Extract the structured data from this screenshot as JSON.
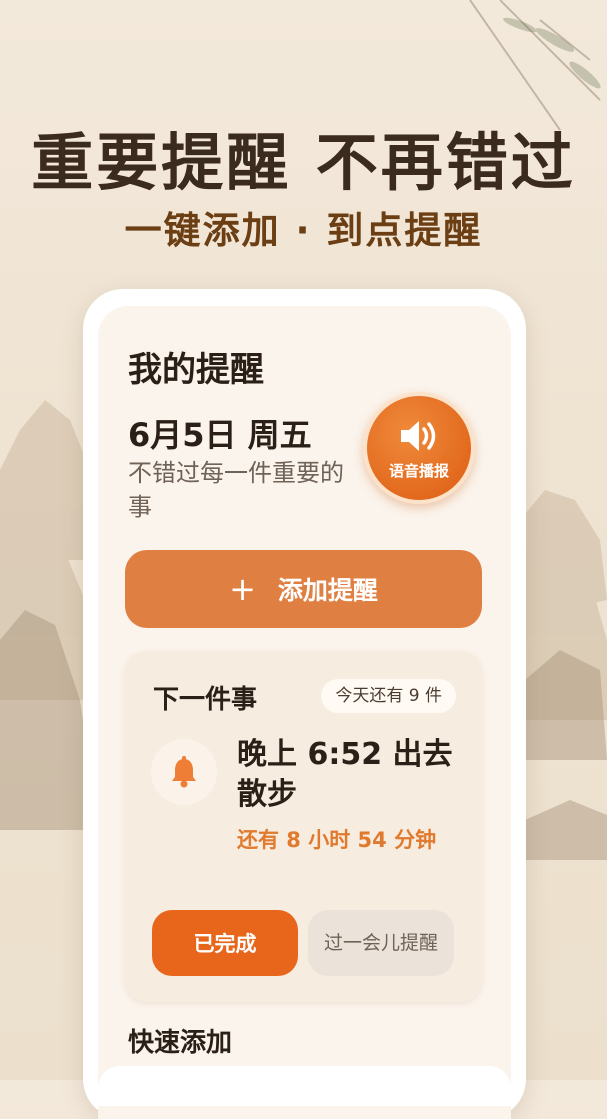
{
  "hero": {
    "headline": "重要提醒 不再错过",
    "subline": "一键添加 · 到点提醒"
  },
  "app": {
    "title": "我的提醒",
    "date": "6月5日 周五",
    "tagline": "不错过每一件重要的事",
    "voice_button": {
      "label": "语音播报",
      "icon": "speaker-icon"
    },
    "add_button": {
      "label": "添加提醒",
      "icon": "plus-icon"
    },
    "next_item": {
      "section_title": "下一件事",
      "remaining_today": "今天还有 9 件",
      "icon": "bell-icon",
      "event": "晚上 6:52 出去散步",
      "countdown": "还有 8 小时 54 分钟",
      "done_label": "已完成",
      "snooze_label": "过一会儿提醒"
    },
    "quick_add": {
      "title": "快速添加"
    }
  },
  "colors": {
    "accent": "#e07f42",
    "accent_dark": "#e8651c",
    "countdown": "#e07a2e",
    "background": "#f3e9db",
    "text": "#2b2018"
  }
}
